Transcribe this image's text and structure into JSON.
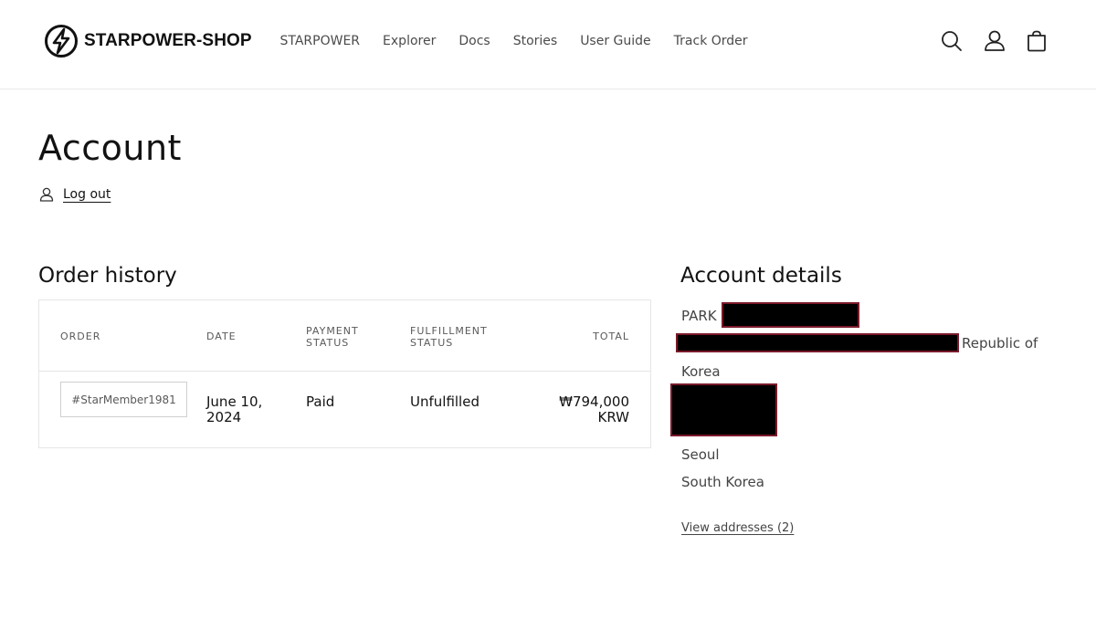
{
  "header": {
    "brand": "STARPOWER-SHOP",
    "nav": [
      {
        "label": "STARPOWER"
      },
      {
        "label": "Explorer"
      },
      {
        "label": "Docs"
      },
      {
        "label": "Stories"
      },
      {
        "label": "User Guide"
      },
      {
        "label": "Track Order"
      }
    ],
    "icons": [
      "search-icon",
      "account-icon",
      "cart-icon"
    ]
  },
  "page": {
    "title": "Account",
    "logout_label": "Log out"
  },
  "order_history": {
    "title": "Order history",
    "columns": {
      "order": "ORDER",
      "date": "DATE",
      "payment_1": "PAYMENT",
      "payment_2": "STATUS",
      "fulfillment_1": "FULFILLMENT",
      "fulfillment_2": "STATUS",
      "total": "TOTAL"
    },
    "rows": [
      {
        "order": "#StarMember1981",
        "date_1": "June 10,",
        "date_2": "2024",
        "payment": "Paid",
        "fulfillment": "Unfulfilled",
        "total_1": "₩794,000",
        "total_2": "KRW"
      }
    ]
  },
  "account_details": {
    "title": "Account details",
    "name_prefix": "PARK",
    "country_line_1": "Republic of",
    "country_line_2": "Korea",
    "city": "Seoul",
    "country": "South Korea",
    "view_addresses": "View addresses (2)"
  }
}
